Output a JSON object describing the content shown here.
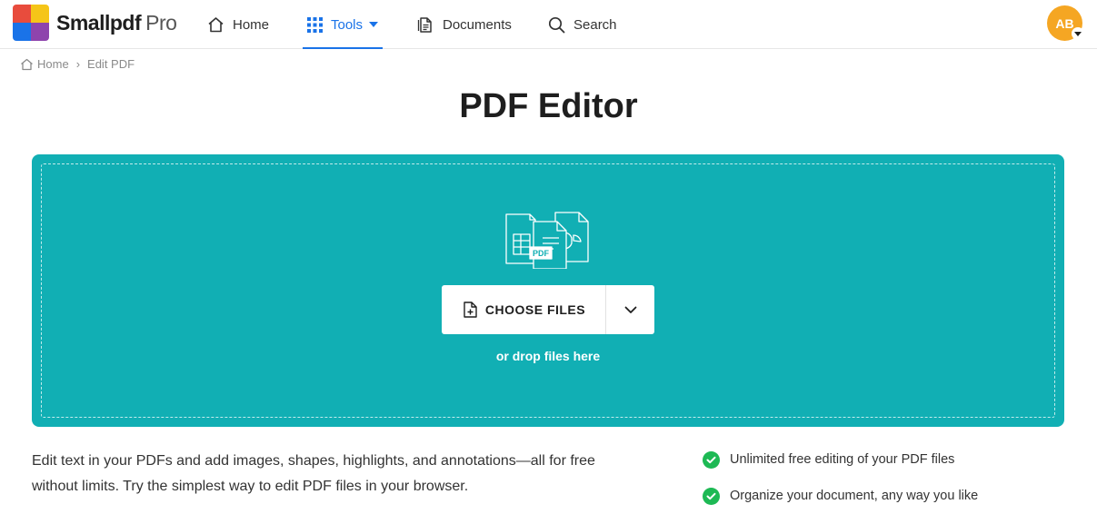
{
  "brand": {
    "name": "Smallpdf",
    "tier": "Pro",
    "colors": [
      "#e84c3d",
      "#f5c518",
      "#1a73e8",
      "#8e44ad"
    ]
  },
  "nav": {
    "home": "Home",
    "tools": "Tools",
    "documents": "Documents",
    "search": "Search",
    "active": "tools",
    "accent": "#1a73e8"
  },
  "user": {
    "initials": "AB",
    "color": "#f5a623"
  },
  "breadcrumb": {
    "home": "Home",
    "separator": "›",
    "current": "Edit PDF"
  },
  "page": {
    "title": "PDF Editor"
  },
  "dropzone": {
    "color": "#11afb4",
    "illustration_label": "PDF",
    "choose_label": "CHOOSE FILES",
    "drop_hint": "or drop files here"
  },
  "description": "Edit text in your PDFs and add images, shapes, highlights, and annotations—all for free without limits. Try the simplest way to edit PDF files in your browser.",
  "features": [
    {
      "text": "Unlimited free editing of your PDF files",
      "icon": "check-circle-icon",
      "color": "#1db954"
    },
    {
      "text": "Organize your document, any way you like",
      "icon": "check-circle-icon",
      "color": "#1db954"
    }
  ]
}
